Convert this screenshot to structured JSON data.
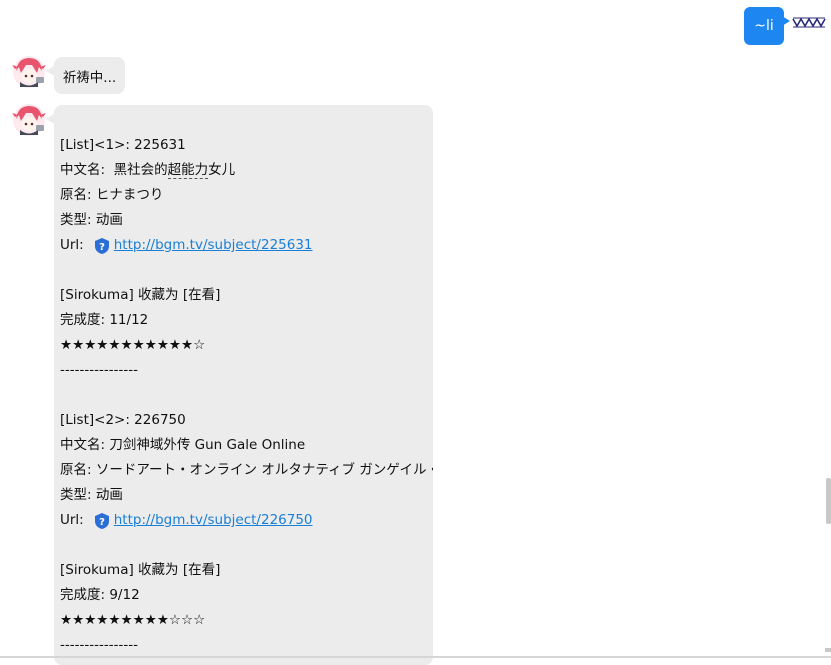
{
  "outgoing": {
    "text": "~li"
  },
  "incoming_status": {
    "text": "祈祷中..."
  },
  "result": {
    "entries": [
      {
        "list_line": "[List]<1>: 225631",
        "cn_label": "中文名:",
        "cn_pre": "黑社会的",
        "cn_dashed": "超能力",
        "cn_post": "女儿",
        "orig_line": "原名: ヒナまつり",
        "type_line": "类型:  动画",
        "url_label": "Url:",
        "url": "http://bgm.tv/subject/225631",
        "user_line": "[Sirokuma] 收藏为 [在看]",
        "progress_line": "完成度: 11/12",
        "stars": "★★★★★★★★★★★☆",
        "divider": "----------------"
      },
      {
        "list_line": "[List]<2>: 226750",
        "cn_line": "中文名:  刀剑神域外传 Gun Gale Online",
        "orig_line": "原名:  ソードアート・オンライン オルタナティブ ガンゲイル・オンライン",
        "type_line": "类型:  动画",
        "url_label": "Url:",
        "url": "http://bgm.tv/subject/226750",
        "user_line": "[Sirokuma] 收藏为 [在看]",
        "progress_line": "完成度: 9/12",
        "stars": "★★★★★★★★★☆☆☆",
        "divider": "----------------"
      }
    ]
  },
  "colors": {
    "outgoing_bubble": "#1e86f0",
    "incoming_bubble": "#ececec",
    "link": "#1a7fd6"
  }
}
